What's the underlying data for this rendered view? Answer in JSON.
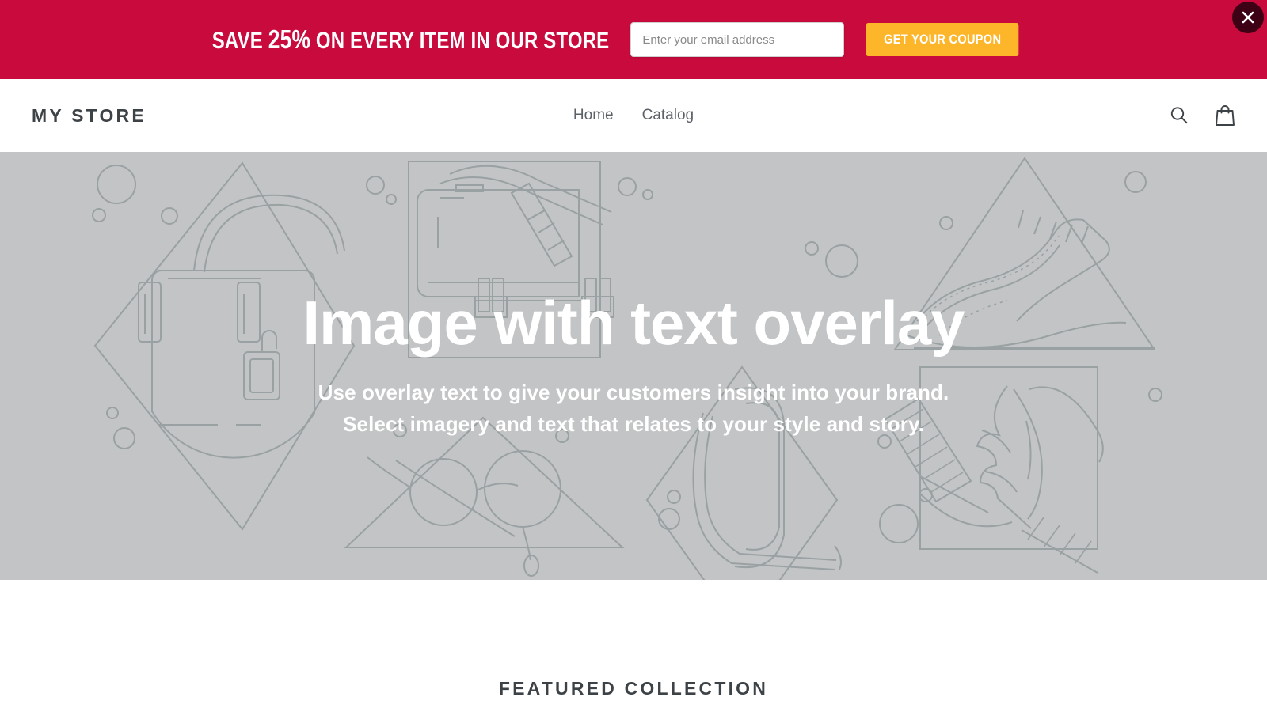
{
  "promo": {
    "text_before": "SAVE ",
    "percent": "25%",
    "text_after": " ON EVERY ITEM IN OUR STORE",
    "email_placeholder": "Enter your email address",
    "email_value": "",
    "button_label": "GET YOUR COUPON",
    "close_icon": "close-x-icon",
    "bar_color": "#c80a3c",
    "button_color": "#fdb52a",
    "close_color": "#3d0014"
  },
  "header": {
    "logo": "MY STORE",
    "nav": [
      {
        "label": "Home"
      },
      {
        "label": "Catalog"
      }
    ],
    "search_icon": "search-icon",
    "cart_icon": "shopping-bag-icon",
    "icon_color": "#3d4246"
  },
  "hero": {
    "title": "Image with text overlay",
    "subtitle_line1": "Use overlay text to give your customers insight into your brand.",
    "subtitle_line2": "Select imagery and text that relates to your style and story.",
    "background_color": "#c2c4c6",
    "art_stroke_color": "#9aa1a3",
    "art_description": "placeholder line-art collage of handbag, messenger bag, glasses, high heel, brogue shoe and quill feather inside diamond, square and triangle frames"
  },
  "featured": {
    "title": "FEATURED COLLECTION"
  }
}
